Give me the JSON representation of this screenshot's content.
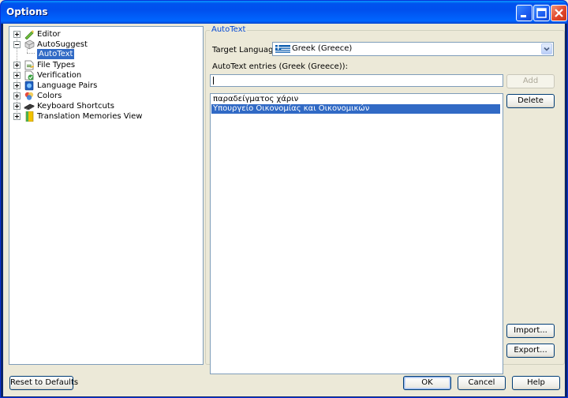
{
  "window": {
    "title": "Options"
  },
  "tree": {
    "items": [
      {
        "label": "Editor",
        "icon": "editor-icon",
        "expander": "plus"
      },
      {
        "label": "AutoSuggest",
        "icon": "autosuggest-icon",
        "expander": "minus"
      },
      {
        "label": "AutoText",
        "icon": "",
        "selected": true,
        "child": true
      },
      {
        "label": "File Types",
        "icon": "file-types-icon",
        "expander": "plus"
      },
      {
        "label": "Verification",
        "icon": "verification-icon",
        "expander": "plus"
      },
      {
        "label": "Language Pairs",
        "icon": "language-pairs-icon",
        "expander": "plus"
      },
      {
        "label": "Colors",
        "icon": "colors-icon",
        "expander": "plus"
      },
      {
        "label": "Keyboard Shortcuts",
        "icon": "keyboard-icon",
        "expander": "plus"
      },
      {
        "label": "Translation Memories View",
        "icon": "tm-view-icon",
        "expander": "plus"
      }
    ]
  },
  "panel": {
    "group_title": "AutoText",
    "target_language_label": "Target Language:",
    "target_language_value": "Greek (Greece)",
    "entries_label": "AutoText entries (Greek (Greece)):",
    "entry_input_value": "",
    "entries": [
      {
        "text": "παραδείγματος χάριν",
        "selected": false
      },
      {
        "text": "Υπουργείο Οικονομίας και Οικονομικών",
        "selected": true
      }
    ],
    "add_label": "Add",
    "delete_label": "Delete",
    "import_label": "Import...",
    "export_label": "Export..."
  },
  "footer": {
    "reset_label": "Reset to Defaults",
    "ok_label": "OK",
    "cancel_label": "Cancel",
    "help_label": "Help"
  },
  "colors": {
    "titlebar": "#0054e3",
    "selection": "#316ac5",
    "group_title": "#0046d5",
    "dialog_bg": "#ece9d8"
  }
}
